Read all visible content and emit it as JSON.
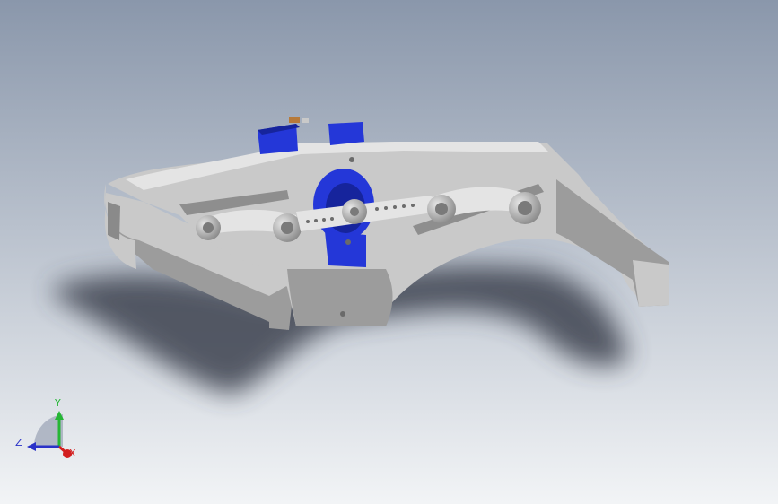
{
  "viewport": {
    "background_top": "#8a97ab",
    "background_bottom": "#f2f4f6"
  },
  "model": {
    "body_color": "#c9c9c9",
    "body_shade": "#9c9c9c",
    "body_light": "#e4e4e4",
    "servo_color": "#2437d8",
    "servo_dark": "#16249c",
    "shadow_color": "#3c4350"
  },
  "triad": {
    "axes": [
      {
        "label": "Y",
        "color": "#25b635",
        "icon": "y-axis-arrow"
      },
      {
        "label": "Z",
        "color": "#2a32c8",
        "icon": "z-axis-arrow"
      },
      {
        "label": "X",
        "color": "#d21e1e",
        "icon": "x-axis-arrow"
      }
    ]
  }
}
